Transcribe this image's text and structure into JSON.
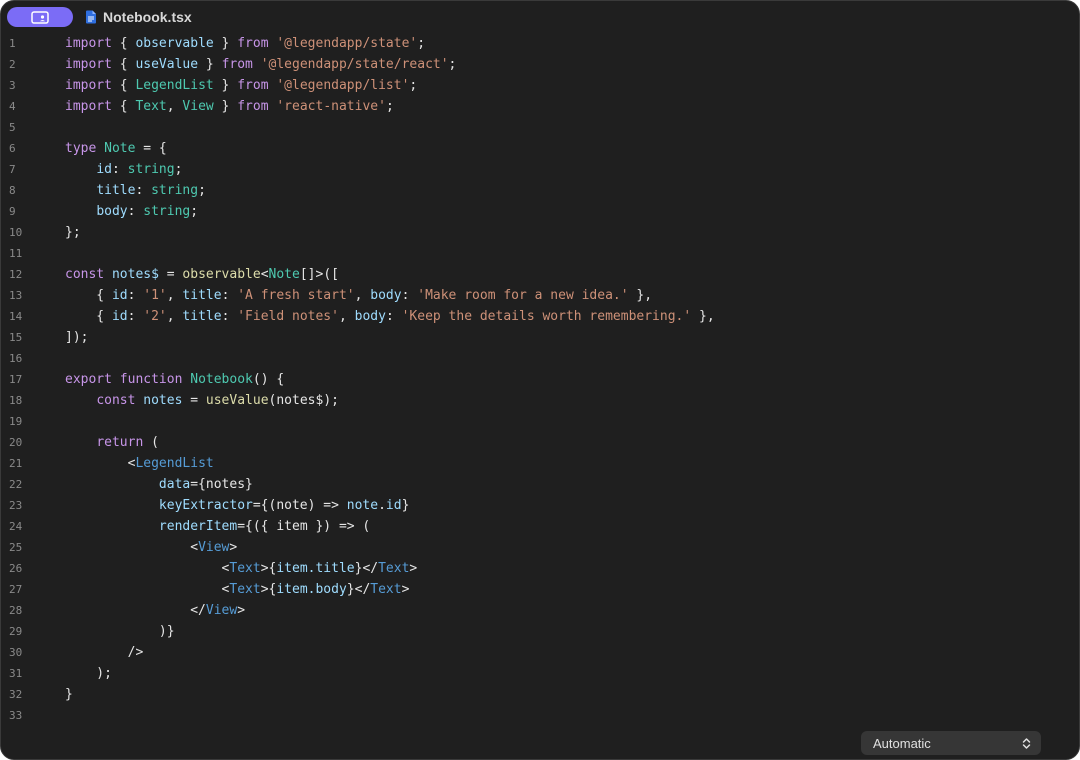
{
  "titlebar": {
    "file_name": "Notebook.tsx",
    "view_button_icon": "display-icon"
  },
  "colors": {
    "accent": "#7b6cf6",
    "background": "#1f1f1f",
    "keyword": "#c795e8",
    "identifier": "#9fdcfe",
    "type": "#4ec9b0",
    "string": "#ce9178",
    "function": "#dcdcaa",
    "jsx_tag": "#569cd6"
  },
  "editor": {
    "lines": [
      {
        "n": "1",
        "tokens": [
          {
            "t": "import",
            "c": "keyword"
          },
          {
            "t": " { ",
            "c": "plain"
          },
          {
            "t": "observable",
            "c": "ident"
          },
          {
            "t": " } ",
            "c": "plain"
          },
          {
            "t": "from",
            "c": "keyword"
          },
          {
            "t": " ",
            "c": "plain"
          },
          {
            "t": "'@legendapp/state'",
            "c": "string"
          },
          {
            "t": ";",
            "c": "plain"
          }
        ]
      },
      {
        "n": "2",
        "tokens": [
          {
            "t": "import",
            "c": "keyword"
          },
          {
            "t": " { ",
            "c": "plain"
          },
          {
            "t": "useValue",
            "c": "ident"
          },
          {
            "t": " } ",
            "c": "plain"
          },
          {
            "t": "from",
            "c": "keyword"
          },
          {
            "t": " ",
            "c": "plain"
          },
          {
            "t": "'@legendapp/state/react'",
            "c": "string"
          },
          {
            "t": ";",
            "c": "plain"
          }
        ]
      },
      {
        "n": "3",
        "tokens": [
          {
            "t": "import",
            "c": "keyword"
          },
          {
            "t": " { ",
            "c": "plain"
          },
          {
            "t": "LegendList",
            "c": "type"
          },
          {
            "t": " } ",
            "c": "plain"
          },
          {
            "t": "from",
            "c": "keyword"
          },
          {
            "t": " ",
            "c": "plain"
          },
          {
            "t": "'@legendapp/list'",
            "c": "string"
          },
          {
            "t": ";",
            "c": "plain"
          }
        ]
      },
      {
        "n": "4",
        "tokens": [
          {
            "t": "import",
            "c": "keyword"
          },
          {
            "t": " { ",
            "c": "plain"
          },
          {
            "t": "Text",
            "c": "type"
          },
          {
            "t": ", ",
            "c": "plain"
          },
          {
            "t": "View",
            "c": "type"
          },
          {
            "t": " } ",
            "c": "plain"
          },
          {
            "t": "from",
            "c": "keyword"
          },
          {
            "t": " ",
            "c": "plain"
          },
          {
            "t": "'react-native'",
            "c": "string"
          },
          {
            "t": ";",
            "c": "plain"
          }
        ]
      },
      {
        "n": "5",
        "tokens": []
      },
      {
        "n": "6",
        "tokens": [
          {
            "t": "type",
            "c": "keyword"
          },
          {
            "t": " ",
            "c": "plain"
          },
          {
            "t": "Note",
            "c": "type"
          },
          {
            "t": " = {",
            "c": "plain"
          }
        ]
      },
      {
        "n": "7",
        "tokens": [
          {
            "t": "    ",
            "c": "plain"
          },
          {
            "t": "id",
            "c": "ident"
          },
          {
            "t": ": ",
            "c": "plain"
          },
          {
            "t": "string",
            "c": "type"
          },
          {
            "t": ";",
            "c": "plain"
          }
        ]
      },
      {
        "n": "8",
        "tokens": [
          {
            "t": "    ",
            "c": "plain"
          },
          {
            "t": "title",
            "c": "ident"
          },
          {
            "t": ": ",
            "c": "plain"
          },
          {
            "t": "string",
            "c": "type"
          },
          {
            "t": ";",
            "c": "plain"
          }
        ]
      },
      {
        "n": "9",
        "tokens": [
          {
            "t": "    ",
            "c": "plain"
          },
          {
            "t": "body",
            "c": "ident"
          },
          {
            "t": ": ",
            "c": "plain"
          },
          {
            "t": "string",
            "c": "type"
          },
          {
            "t": ";",
            "c": "plain"
          }
        ]
      },
      {
        "n": "10",
        "tokens": [
          {
            "t": "};",
            "c": "plain"
          }
        ]
      },
      {
        "n": "11",
        "tokens": []
      },
      {
        "n": "12",
        "tokens": [
          {
            "t": "const",
            "c": "keyword"
          },
          {
            "t": " ",
            "c": "plain"
          },
          {
            "t": "notes$",
            "c": "ident"
          },
          {
            "t": " = ",
            "c": "plain"
          },
          {
            "t": "observable",
            "c": "func"
          },
          {
            "t": "<",
            "c": "plain"
          },
          {
            "t": "Note",
            "c": "type"
          },
          {
            "t": "[]>([",
            "c": "plain"
          }
        ]
      },
      {
        "n": "13",
        "tokens": [
          {
            "t": "    { ",
            "c": "plain"
          },
          {
            "t": "id",
            "c": "ident"
          },
          {
            "t": ": ",
            "c": "plain"
          },
          {
            "t": "'1'",
            "c": "string"
          },
          {
            "t": ", ",
            "c": "plain"
          },
          {
            "t": "title",
            "c": "ident"
          },
          {
            "t": ": ",
            "c": "plain"
          },
          {
            "t": "'A fresh start'",
            "c": "string"
          },
          {
            "t": ", ",
            "c": "plain"
          },
          {
            "t": "body",
            "c": "ident"
          },
          {
            "t": ": ",
            "c": "plain"
          },
          {
            "t": "'Make room for a new idea.'",
            "c": "string"
          },
          {
            "t": " },",
            "c": "plain"
          }
        ]
      },
      {
        "n": "14",
        "tokens": [
          {
            "t": "    { ",
            "c": "plain"
          },
          {
            "t": "id",
            "c": "ident"
          },
          {
            "t": ": ",
            "c": "plain"
          },
          {
            "t": "'2'",
            "c": "string"
          },
          {
            "t": ", ",
            "c": "plain"
          },
          {
            "t": "title",
            "c": "ident"
          },
          {
            "t": ": ",
            "c": "plain"
          },
          {
            "t": "'Field notes'",
            "c": "string"
          },
          {
            "t": ", ",
            "c": "plain"
          },
          {
            "t": "body",
            "c": "ident"
          },
          {
            "t": ": ",
            "c": "plain"
          },
          {
            "t": "'Keep the details worth remembering.'",
            "c": "string"
          },
          {
            "t": " },",
            "c": "plain"
          }
        ]
      },
      {
        "n": "15",
        "tokens": [
          {
            "t": "]);",
            "c": "plain"
          }
        ]
      },
      {
        "n": "16",
        "tokens": []
      },
      {
        "n": "17",
        "tokens": [
          {
            "t": "export",
            "c": "keyword"
          },
          {
            "t": " ",
            "c": "plain"
          },
          {
            "t": "function",
            "c": "keyword"
          },
          {
            "t": " ",
            "c": "plain"
          },
          {
            "t": "Notebook",
            "c": "type"
          },
          {
            "t": "() {",
            "c": "plain"
          }
        ]
      },
      {
        "n": "18",
        "tokens": [
          {
            "t": "    ",
            "c": "plain"
          },
          {
            "t": "const",
            "c": "keyword"
          },
          {
            "t": " ",
            "c": "plain"
          },
          {
            "t": "notes",
            "c": "ident"
          },
          {
            "t": " = ",
            "c": "plain"
          },
          {
            "t": "useValue",
            "c": "func"
          },
          {
            "t": "(notes$);",
            "c": "plain"
          }
        ]
      },
      {
        "n": "19",
        "tokens": []
      },
      {
        "n": "20",
        "tokens": [
          {
            "t": "    ",
            "c": "plain"
          },
          {
            "t": "return",
            "c": "keyword"
          },
          {
            "t": " (",
            "c": "plain"
          }
        ]
      },
      {
        "n": "21",
        "tokens": [
          {
            "t": "        <",
            "c": "plain"
          },
          {
            "t": "LegendList",
            "c": "jsx"
          }
        ]
      },
      {
        "n": "22",
        "tokens": [
          {
            "t": "            ",
            "c": "plain"
          },
          {
            "t": "data",
            "c": "ident"
          },
          {
            "t": "={notes}",
            "c": "plain"
          }
        ]
      },
      {
        "n": "23",
        "tokens": [
          {
            "t": "            ",
            "c": "plain"
          },
          {
            "t": "keyExtractor",
            "c": "ident"
          },
          {
            "t": "={(note) => ",
            "c": "plain"
          },
          {
            "t": "note",
            "c": "ident"
          },
          {
            "t": ".",
            "c": "plain"
          },
          {
            "t": "id",
            "c": "ident"
          },
          {
            "t": "}",
            "c": "plain"
          }
        ]
      },
      {
        "n": "24",
        "tokens": [
          {
            "t": "            ",
            "c": "plain"
          },
          {
            "t": "renderItem",
            "c": "ident"
          },
          {
            "t": "={({ item }) => (",
            "c": "plain"
          }
        ]
      },
      {
        "n": "25",
        "tokens": [
          {
            "t": "                <",
            "c": "plain"
          },
          {
            "t": "View",
            "c": "jsx"
          },
          {
            "t": ">",
            "c": "plain"
          }
        ]
      },
      {
        "n": "26",
        "tokens": [
          {
            "t": "                    <",
            "c": "plain"
          },
          {
            "t": "Text",
            "c": "jsx"
          },
          {
            "t": ">{",
            "c": "plain"
          },
          {
            "t": "item.title",
            "c": "ident"
          },
          {
            "t": "}</",
            "c": "plain"
          },
          {
            "t": "Text",
            "c": "jsx"
          },
          {
            "t": ">",
            "c": "plain"
          }
        ]
      },
      {
        "n": "27",
        "tokens": [
          {
            "t": "                    <",
            "c": "plain"
          },
          {
            "t": "Text",
            "c": "jsx"
          },
          {
            "t": ">{",
            "c": "plain"
          },
          {
            "t": "item.body",
            "c": "ident"
          },
          {
            "t": "}</",
            "c": "plain"
          },
          {
            "t": "Text",
            "c": "jsx"
          },
          {
            "t": ">",
            "c": "plain"
          }
        ]
      },
      {
        "n": "28",
        "tokens": [
          {
            "t": "                </",
            "c": "plain"
          },
          {
            "t": "View",
            "c": "jsx"
          },
          {
            "t": ">",
            "c": "plain"
          }
        ]
      },
      {
        "n": "29",
        "tokens": [
          {
            "t": "            )}",
            "c": "plain"
          }
        ]
      },
      {
        "n": "30",
        "tokens": [
          {
            "t": "        />",
            "c": "plain"
          }
        ]
      },
      {
        "n": "31",
        "tokens": [
          {
            "t": "    );",
            "c": "plain"
          }
        ]
      },
      {
        "n": "32",
        "tokens": [
          {
            "t": "}",
            "c": "plain"
          }
        ]
      },
      {
        "n": "33",
        "tokens": []
      }
    ]
  },
  "footer": {
    "language_mode": "Automatic",
    "language_mode_icon": "chevron-updown-icon"
  }
}
